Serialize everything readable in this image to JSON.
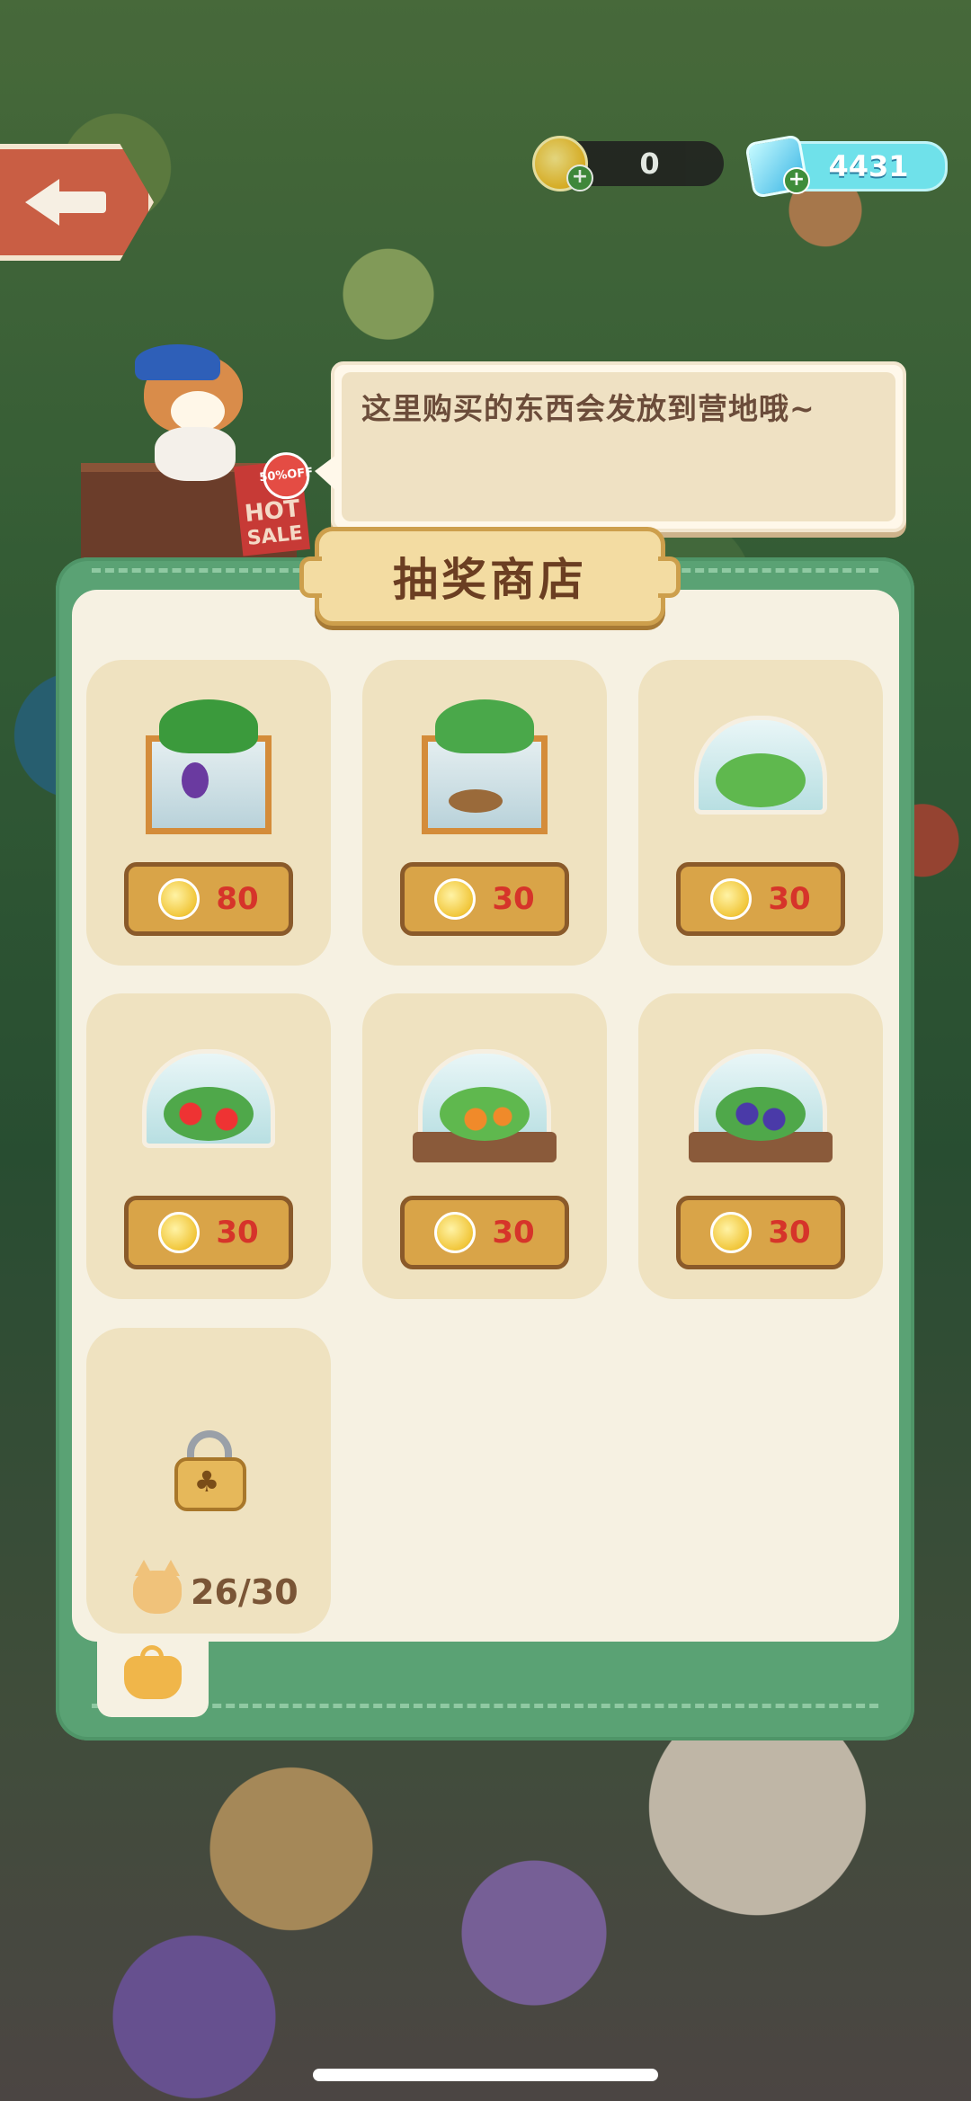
{
  "currency": {
    "coins": "0",
    "gems": "4431"
  },
  "speech": "这里购买的东西会发放到营地哦~",
  "sale_tag": {
    "percent": "50%",
    "off": "OFF",
    "hot": "HOT",
    "sale": "SALE"
  },
  "shop": {
    "title": "抽奖商店",
    "items": [
      {
        "icon": "eggplant-shelf",
        "price": "80"
      },
      {
        "icon": "potato-shelf",
        "price": "30"
      },
      {
        "icon": "cabbage-greenhouse",
        "price": "30"
      },
      {
        "icon": "strawberry-greenhouse",
        "price": "30"
      },
      {
        "icon": "carrot-greenhouse",
        "price": "30"
      },
      {
        "icon": "grape-greenhouse",
        "price": "30"
      }
    ],
    "locked_item": {
      "icon": "club-lock-icon",
      "progress": "26/30"
    }
  },
  "colors": {
    "panel_green": "#5aa274",
    "price_red": "#d6342a",
    "button_gold": "#d9a448"
  }
}
